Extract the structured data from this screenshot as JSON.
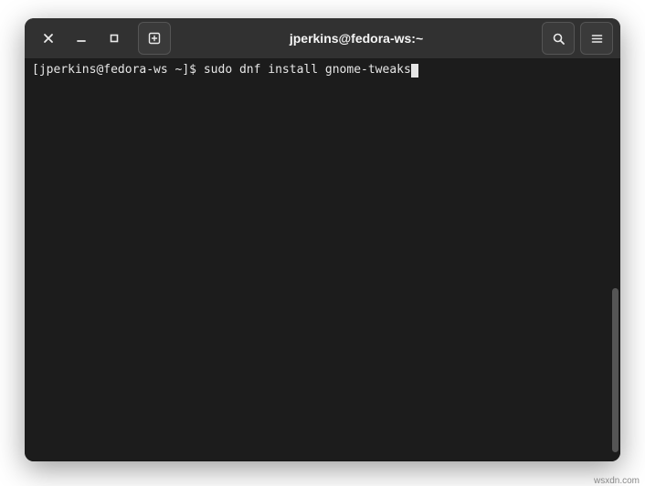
{
  "window": {
    "title": "jperkins@fedora-ws:~"
  },
  "terminal": {
    "prompt": "[jperkins@fedora-ws ~]$ ",
    "command": "sudo dnf install gnome-tweaks"
  },
  "watermark": "wsxdn.com"
}
